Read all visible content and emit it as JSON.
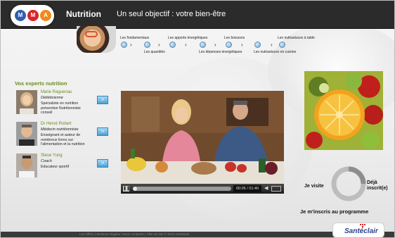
{
  "header": {
    "title": "Nutrition",
    "tagline": "Un seul objectif : votre bien-être",
    "logo_letters": [
      "M",
      "M",
      "A"
    ],
    "logo_colors": [
      "#2f5fb0",
      "#d8232a",
      "#f08a1c"
    ]
  },
  "steps": {
    "top_labels": [
      "Les fondamentaux",
      "Les apports énergétiques",
      "Les boissons",
      "Les nutriastuces à table"
    ],
    "bottom_labels": [
      "Les quantités",
      "Les dépenses énergétiques",
      "Les nutriastuces en cuisine"
    ]
  },
  "experts": {
    "title": "Vos experts nutrition",
    "items": [
      {
        "name": "Marie Raguenau",
        "role": "Diététicienne",
        "desc": "Spécialiste en nutrition préventive Nutritionniste conseil",
        "button": ">"
      },
      {
        "name": "Dr Hervé Robert",
        "role": "Médecin nutritionniste",
        "desc": "Enseignant et auteur de nombreux livres sur l'alimentation et la nutrition",
        "button": ">"
      },
      {
        "name": "Steve Yung",
        "role": "Coach",
        "desc": "Educateur sportif",
        "button": ">"
      }
    ]
  },
  "video": {
    "time": "00:05 / 01:40",
    "progress_fraction": 0.04
  },
  "signup": {
    "visit_label": "Je visite",
    "already_label": "Déjà inscrit(e)",
    "register_label": "Je m'inscris au programme"
  },
  "footer": {
    "text": "Les Offres | Mentions légales | Nous contacter | Plan du site © 2010 Santéclair",
    "brand": "Santéclair"
  },
  "colors": {
    "accent_green": "#6c8a1f",
    "header_bg": "#2b2b2b",
    "step_blue": "#6fa9cf"
  }
}
